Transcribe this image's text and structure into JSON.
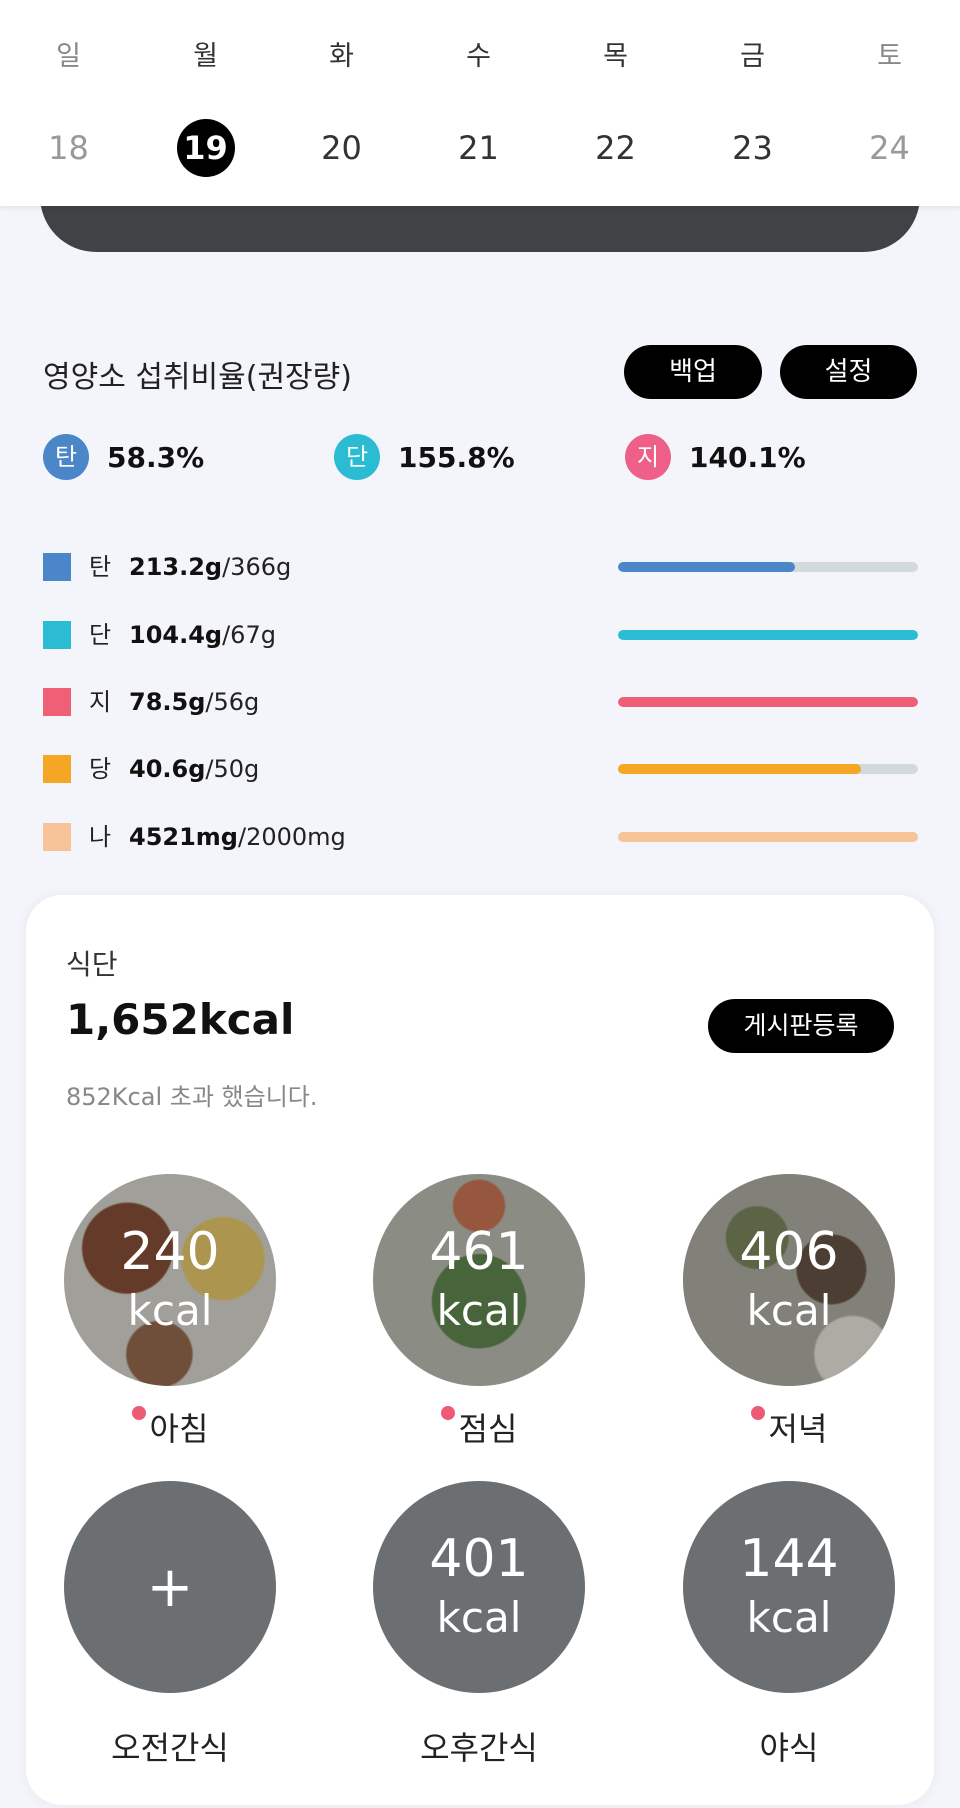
{
  "week": {
    "days": [
      {
        "dow": "일",
        "date": "18",
        "weekend": true,
        "selected": false
      },
      {
        "dow": "월",
        "date": "19",
        "weekend": false,
        "selected": true
      },
      {
        "dow": "화",
        "date": "20",
        "weekend": false,
        "selected": false
      },
      {
        "dow": "수",
        "date": "21",
        "weekend": false,
        "selected": false
      },
      {
        "dow": "목",
        "date": "22",
        "weekend": false,
        "selected": false
      },
      {
        "dow": "금",
        "date": "23",
        "weekend": false,
        "selected": false
      },
      {
        "dow": "토",
        "date": "24",
        "weekend": true,
        "selected": false
      }
    ]
  },
  "nutrition": {
    "title": "영양소 섭취비율(권장량)",
    "backup_label": "백업",
    "settings_label": "설정",
    "ratios": [
      {
        "badge": "탄",
        "pct": "58.3%",
        "color": "#4a86c8"
      },
      {
        "badge": "단",
        "pct": "155.8%",
        "color": "#2bbcd4"
      },
      {
        "badge": "지",
        "pct": "140.1%",
        "color": "#ef6088"
      }
    ],
    "rows": [
      {
        "label": "탄",
        "amount": "213.2g",
        "target": "/366g",
        "color": "#4a86c8",
        "fill": 0.583
      },
      {
        "label": "단",
        "amount": "104.4g",
        "target": "/67g",
        "color": "#2bbcd4",
        "fill": 1.0
      },
      {
        "label": "지",
        "amount": "78.5g",
        "target": "/56g",
        "color": "#ef6077",
        "fill": 1.0
      },
      {
        "label": "당",
        "amount": "40.6g",
        "target": "/50g",
        "color": "#f5a623",
        "fill": 0.812
      },
      {
        "label": "나",
        "amount": "4521mg",
        "target": "/2000mg",
        "color": "#f7c49a",
        "fill": 1.0
      }
    ]
  },
  "meals": {
    "label": "식단",
    "total": "1,652kcal",
    "board_label": "게시판등록",
    "over_text": "852Kcal 초과 했습니다.",
    "items": [
      {
        "name": "아침",
        "kcal": "240",
        "unit": "kcal",
        "photo": true,
        "dot": true
      },
      {
        "name": "점심",
        "kcal": "461",
        "unit": "kcal",
        "photo": true,
        "dot": true
      },
      {
        "name": "저녁",
        "kcal": "406",
        "unit": "kcal",
        "photo": true,
        "dot": true
      },
      {
        "name": "오전간식",
        "kcal": "+",
        "unit": "",
        "photo": false,
        "dot": false
      },
      {
        "name": "오후간식",
        "kcal": "401",
        "unit": "kcal",
        "photo": false,
        "dot": false
      },
      {
        "name": "야식",
        "kcal": "144",
        "unit": "kcal",
        "photo": false,
        "dot": false
      }
    ]
  }
}
